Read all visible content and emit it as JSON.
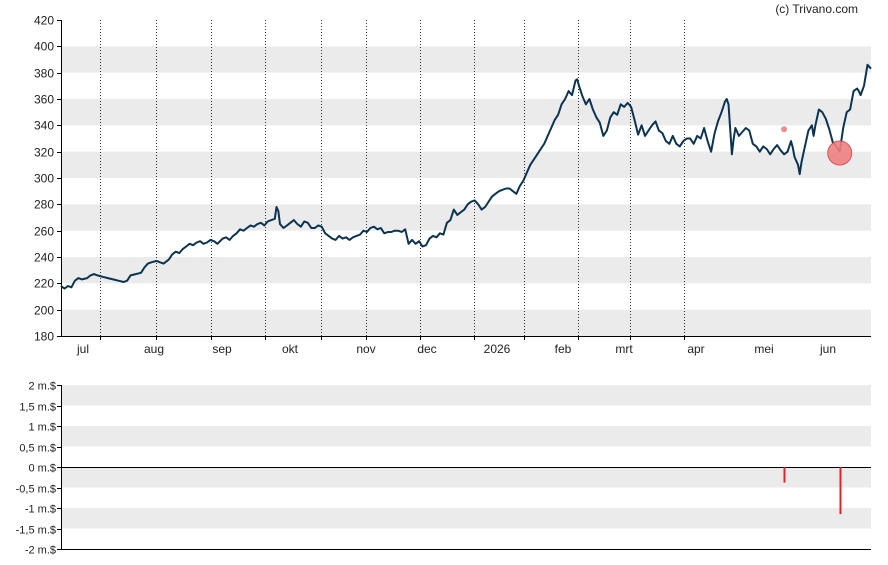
{
  "credit": "(c) Trivano.com",
  "colors": {
    "price_line": "#0b3452",
    "band": "#ebebeb",
    "marker": "#f08080",
    "volume_bar": "#e8202a",
    "axis": "#000000"
  },
  "chart_data": [
    {
      "type": "line",
      "series": [
        {
          "values": [
            [
              0,
              218
            ],
            [
              2,
              216
            ],
            [
              4,
              218
            ],
            [
              6,
              217
            ],
            [
              8,
              222
            ],
            [
              10,
              224
            ],
            [
              12,
              223
            ],
            [
              15,
              224
            ],
            [
              17,
              226
            ],
            [
              19,
              227
            ],
            [
              21,
              226
            ],
            [
              24,
              225
            ],
            [
              27,
              224
            ],
            [
              30,
              223
            ],
            [
              33,
              222
            ],
            [
              36,
              221
            ],
            [
              38,
              222
            ],
            [
              40,
              226
            ],
            [
              43,
              227
            ],
            [
              46,
              228
            ],
            [
              48,
              232
            ],
            [
              50,
              235
            ],
            [
              52,
              236
            ],
            [
              55,
              237
            ],
            [
              57,
              236
            ],
            [
              59,
              235
            ],
            [
              62,
              238
            ],
            [
              64,
              242
            ],
            [
              66,
              244
            ],
            [
              68,
              243
            ],
            [
              70,
              246
            ],
            [
              72,
              248
            ],
            [
              74,
              250
            ],
            [
              76,
              249
            ],
            [
              78,
              251
            ],
            [
              80,
              252
            ],
            [
              82,
              250
            ],
            [
              84,
              251
            ],
            [
              86,
              253
            ],
            [
              88,
              252
            ],
            [
              90,
              250
            ],
            [
              93,
              254
            ],
            [
              95,
              255
            ],
            [
              97,
              253
            ],
            [
              99,
              256
            ],
            [
              101,
              258
            ],
            [
              103,
              261
            ],
            [
              105,
              260
            ],
            [
              107,
              262
            ],
            [
              109,
              264
            ],
            [
              111,
              263
            ],
            [
              113,
              265
            ],
            [
              115,
              266
            ],
            [
              117,
              264
            ],
            [
              119,
              267
            ],
            [
              121,
              268
            ],
            [
              123,
              269
            ],
            [
              124,
              278
            ],
            [
              125,
              275
            ],
            [
              126,
              265
            ],
            [
              128,
              262
            ],
            [
              130,
              264
            ],
            [
              132,
              266
            ],
            [
              134,
              268
            ],
            [
              136,
              265
            ],
            [
              138,
              263
            ],
            [
              140,
              267
            ],
            [
              142,
              266
            ],
            [
              144,
              262
            ],
            [
              146,
              262
            ],
            [
              148,
              264
            ],
            [
              150,
              263
            ],
            [
              152,
              258
            ],
            [
              154,
              256
            ],
            [
              156,
              254
            ],
            [
              158,
              253
            ],
            [
              160,
              256
            ],
            [
              162,
              254
            ],
            [
              164,
              255
            ],
            [
              166,
              253
            ],
            [
              168,
              255
            ],
            [
              170,
              256
            ],
            [
              172,
              257
            ],
            [
              174,
              260
            ],
            [
              176,
              259
            ],
            [
              178,
              262
            ],
            [
              180,
              263
            ],
            [
              182,
              261
            ],
            [
              184,
              262
            ],
            [
              186,
              258
            ],
            [
              188,
              259
            ],
            [
              190,
              259
            ],
            [
              192,
              260
            ],
            [
              194,
              260
            ],
            [
              196,
              259
            ],
            [
              198,
              261
            ],
            [
              200,
              250
            ],
            [
              202,
              253
            ],
            [
              204,
              250
            ],
            [
              206,
              252
            ],
            [
              208,
              248
            ],
            [
              210,
              249
            ],
            [
              212,
              254
            ],
            [
              214,
              256
            ],
            [
              216,
              255
            ],
            [
              218,
              258
            ],
            [
              220,
              257
            ],
            [
              222,
              266
            ],
            [
              224,
              268
            ],
            [
              226,
              276
            ],
            [
              228,
              272
            ],
            [
              230,
              274
            ],
            [
              232,
              276
            ],
            [
              234,
              280
            ],
            [
              236,
              282
            ],
            [
              238,
              283
            ],
            [
              240,
              280
            ],
            [
              242,
              276
            ],
            [
              244,
              278
            ],
            [
              246,
              282
            ],
            [
              248,
              286
            ],
            [
              250,
              288
            ],
            [
              252,
              290
            ],
            [
              254,
              291
            ],
            [
              256,
              292
            ],
            [
              258,
              292
            ],
            [
              260,
              290
            ],
            [
              262,
              288
            ],
            [
              264,
              294
            ],
            [
              266,
              298
            ],
            [
              268,
              304
            ],
            [
              270,
              310
            ],
            [
              272,
              314
            ],
            [
              274,
              318
            ],
            [
              276,
              322
            ],
            [
              278,
              326
            ],
            [
              280,
              332
            ],
            [
              282,
              338
            ],
            [
              284,
              344
            ],
            [
              286,
              348
            ],
            [
              288,
              356
            ],
            [
              290,
              360
            ],
            [
              292,
              366
            ],
            [
              294,
              363
            ],
            [
              296,
              374
            ],
            [
              297,
              375
            ],
            [
              298,
              370
            ],
            [
              300,
              362
            ],
            [
              302,
              356
            ],
            [
              304,
              360
            ],
            [
              306,
              352
            ],
            [
              308,
              346
            ],
            [
              310,
              342
            ],
            [
              312,
              332
            ],
            [
              314,
              336
            ],
            [
              316,
              346
            ],
            [
              318,
              350
            ],
            [
              320,
              348
            ],
            [
              322,
              356
            ],
            [
              324,
              354
            ],
            [
              326,
              357
            ],
            [
              328,
              354
            ],
            [
              330,
              344
            ],
            [
              332,
              333
            ],
            [
              334,
              340
            ],
            [
              336,
              332
            ],
            [
              338,
              336
            ],
            [
              340,
              340
            ],
            [
              342,
              343
            ],
            [
              344,
              336
            ],
            [
              346,
              334
            ],
            [
              348,
              328
            ],
            [
              350,
              326
            ],
            [
              352,
              332
            ],
            [
              354,
              326
            ],
            [
              356,
              324
            ],
            [
              358,
              328
            ],
            [
              360,
              330
            ],
            [
              362,
              330
            ],
            [
              364,
              326
            ],
            [
              366,
              332
            ],
            [
              368,
              330
            ],
            [
              370,
              338
            ],
            [
              372,
              328
            ],
            [
              374,
              320
            ],
            [
              376,
              334
            ],
            [
              378,
              343
            ],
            [
              380,
              350
            ],
            [
              382,
              358
            ],
            [
              383,
              360
            ],
            [
              384,
              356
            ],
            [
              386,
              318
            ],
            [
              387,
              330
            ],
            [
              388,
              338
            ],
            [
              390,
              332
            ],
            [
              392,
              335
            ],
            [
              394,
              338
            ],
            [
              396,
              336
            ],
            [
              398,
              326
            ],
            [
              400,
              324
            ],
            [
              402,
              320
            ],
            [
              404,
              324
            ],
            [
              406,
              322
            ],
            [
              408,
              318
            ],
            [
              410,
              322
            ],
            [
              412,
              325
            ],
            [
              414,
              321
            ],
            [
              416,
              318
            ],
            [
              418,
              320
            ],
            [
              420,
              328
            ],
            [
              421,
              323
            ],
            [
              422,
              316
            ],
            [
              424,
              310
            ],
            [
              425,
              303
            ],
            [
              426,
              312
            ],
            [
              428,
              324
            ],
            [
              430,
              336
            ],
            [
              432,
              340
            ],
            [
              433,
              332
            ],
            [
              434,
              340
            ],
            [
              436,
              352
            ],
            [
              438,
              350
            ],
            [
              440,
              345
            ],
            [
              442,
              337
            ],
            [
              444,
              327
            ],
            [
              446,
              324
            ],
            [
              448,
              320
            ],
            [
              450,
              338
            ],
            [
              452,
              350
            ],
            [
              454,
              352
            ],
            [
              456,
              366
            ],
            [
              458,
              368
            ],
            [
              459,
              366
            ],
            [
              460,
              363
            ],
            [
              462,
              370
            ],
            [
              464,
              386
            ],
            [
              466,
              383
            ]
          ]
        }
      ],
      "x_tick_labels": [
        "jul",
        "aug",
        "sep",
        "okt",
        "nov",
        "dec",
        "2026",
        "feb",
        "mrt",
        "apr",
        "mei",
        "jun"
      ],
      "y_tick_labels": [
        "180",
        "200",
        "220",
        "240",
        "260",
        "280",
        "300",
        "320",
        "340",
        "360",
        "380",
        "400",
        "420"
      ],
      "ylim": [
        180,
        420
      ],
      "grid": "dotted vertical lines at month boundaries, alternating grey horizontal bands",
      "markers": [
        {
          "x": 416,
          "y": 337,
          "size": "small"
        },
        {
          "x": 448,
          "y": 319,
          "size": "large"
        }
      ]
    },
    {
      "type": "bar",
      "y_tick_labels": [
        "2 m.$",
        "1,5 m.$",
        "1 m.$",
        "0,5 m.$",
        "0 m.$",
        "-0,5 m.$",
        "-1 m.$",
        "-1,5 m.$",
        "-2 m.$"
      ],
      "ylim": [
        -2,
        2
      ],
      "unit": "m.$",
      "bars": [
        {
          "x": 416,
          "value": -0.38
        },
        {
          "x": 448,
          "value": -1.15
        }
      ]
    }
  ]
}
